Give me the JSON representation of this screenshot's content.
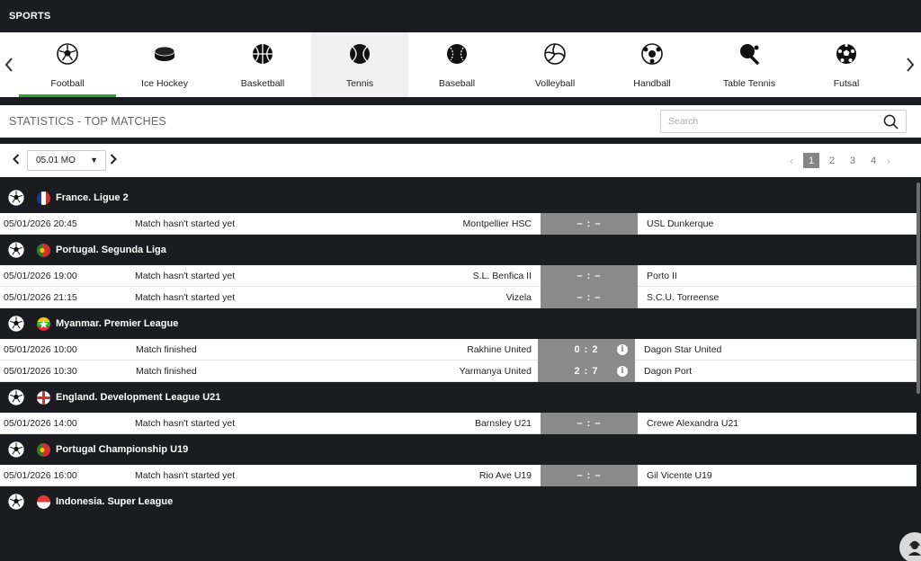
{
  "header": {
    "title": "SPORTS"
  },
  "sports": [
    {
      "label": "Football",
      "icon": "soccer-ball-icon",
      "selected": true
    },
    {
      "label": "Ice Hockey",
      "icon": "hockey-puck-icon"
    },
    {
      "label": "Basketball",
      "icon": "basketball-icon"
    },
    {
      "label": "Tennis",
      "icon": "tennis-ball-icon",
      "hover": true
    },
    {
      "label": "Baseball",
      "icon": "baseball-icon"
    },
    {
      "label": "Volleyball",
      "icon": "volleyball-icon"
    },
    {
      "label": "Handball",
      "icon": "handball-icon"
    },
    {
      "label": "Table Tennis",
      "icon": "table-tennis-icon"
    },
    {
      "label": "Futsal",
      "icon": "futsal-ball-icon"
    }
  ],
  "stats": {
    "title": "STATISTICS - TOP MATCHES",
    "search_placeholder": "Search"
  },
  "date": {
    "selected": "05.01 MO"
  },
  "pagination": {
    "pages": [
      "1",
      "2",
      "3",
      "4"
    ],
    "current": "1"
  },
  "leagues": [
    {
      "name": "France. Ligue 2",
      "flag": "france",
      "matches": [
        {
          "datetime": "05/01/2026 20:45",
          "status": "Match hasn't started yet",
          "home": "Montpellier HSC",
          "score": "– : –",
          "away": "USL Dunkerque",
          "finished": false
        }
      ]
    },
    {
      "name": "Portugal. Segunda Liga",
      "flag": "portugal",
      "matches": [
        {
          "datetime": "05/01/2026 19:00",
          "status": "Match hasn't started yet",
          "home": "S.L. Benfica II",
          "score": "– : –",
          "away": "Porto II",
          "finished": false
        },
        {
          "datetime": "05/01/2026 21:15",
          "status": "Match hasn't started yet",
          "home": "Vizela",
          "score": "– : –",
          "away": "S.C.U. Torreense",
          "finished": false
        }
      ]
    },
    {
      "name": "Myanmar. Premier League",
      "flag": "myanmar",
      "matches": [
        {
          "datetime": "05/01/2026 10:00",
          "status": "Match finished",
          "home": "Rakhine United",
          "score": "0 : 2",
          "away": "Dagon Star United",
          "finished": true
        },
        {
          "datetime": "05/01/2026 10:30",
          "status": "Match finished",
          "home": "Yarmanya United",
          "score": "2 : 7",
          "away": "Dagon Port",
          "finished": true
        }
      ]
    },
    {
      "name": "England. Development League U21",
      "flag": "england",
      "matches": [
        {
          "datetime": "05/01/2026 14:00",
          "status": "Match hasn't started yet",
          "home": "Barnsley U21",
          "score": "– : –",
          "away": "Crewe Alexandra U21",
          "finished": false
        }
      ]
    },
    {
      "name": "Portugal Championship U19",
      "flag": "portugal",
      "matches": [
        {
          "datetime": "05/01/2026 16:00",
          "status": "Match hasn't started yet",
          "home": "Rio Ave U19",
          "score": "– : –",
          "away": "Gil Vicente U19",
          "finished": false
        }
      ]
    },
    {
      "name": "Indonesia. Super League",
      "flag": "indonesia",
      "matches": []
    }
  ],
  "colors": {
    "dark": "#1b1c1f",
    "accent_green": "#2ea12e",
    "score_bg": "#8a8a8a"
  }
}
